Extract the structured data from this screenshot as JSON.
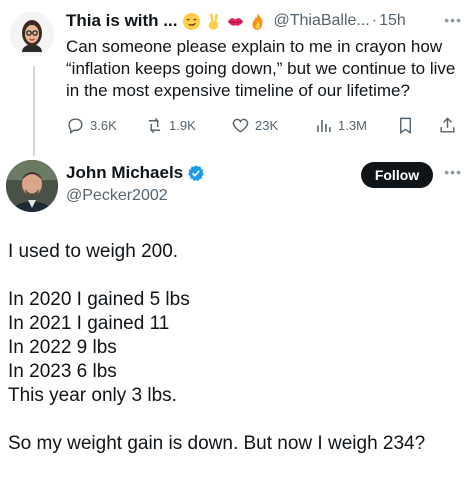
{
  "quoted_tweet": {
    "display_name": "Thia is with ...",
    "handle": "@ThiaBalle...",
    "dot": "·",
    "time": "15h",
    "text": "Can someone please explain to me in crayon how “inflation keeps going down,” but we continue to live in the most expensive timeline of our lifetime?",
    "emoji_icons": [
      "smirk-face-icon",
      "victory-hand-icon",
      "kiss-mark-icon",
      "fire-icon"
    ],
    "stats": {
      "replies": "3.6K",
      "reposts": "1.9K",
      "likes": "23K",
      "views": "1.3M"
    }
  },
  "main_tweet": {
    "display_name": "John Michaels",
    "handle": "@Pecker2002",
    "follow_label": "Follow",
    "paragraphs": [
      [
        "I used to weigh 200."
      ],
      [
        "In 2020 I gained 5 lbs",
        "In 2021 I gained 11",
        "In 2022 9 lbs",
        "In 2023 6 lbs",
        "This year only 3 lbs."
      ],
      [
        "So my weight gain is down. But now I weigh 234?"
      ]
    ]
  },
  "colors": {
    "verified": "#1d9bf0",
    "muted": "#536471",
    "text": "#0f1419",
    "button": "#0f1419"
  }
}
